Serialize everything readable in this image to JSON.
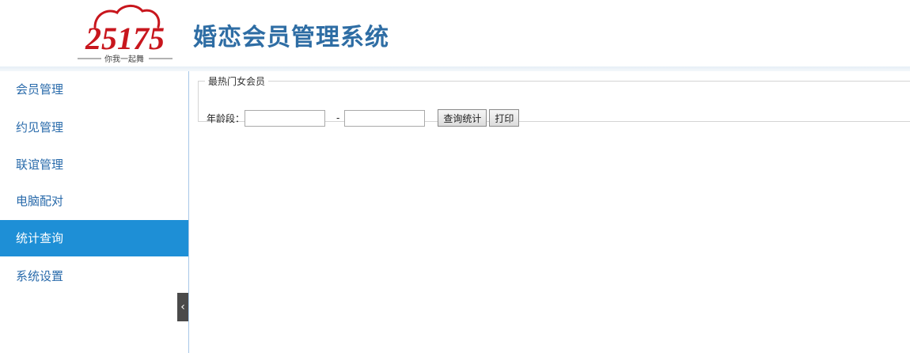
{
  "header": {
    "logo_number": "25175",
    "logo_slogan": "你我一起舞",
    "title": "婚恋会员管理系统",
    "accent_color": "#2e6da4",
    "logo_color": "#c8161d"
  },
  "sidebar": {
    "items": [
      {
        "label": "会员管理",
        "active": false
      },
      {
        "label": "约见管理",
        "active": false
      },
      {
        "label": "联谊管理",
        "active": false
      },
      {
        "label": "电脑配对",
        "active": false
      },
      {
        "label": "统计查询",
        "active": true
      },
      {
        "label": "系统设置",
        "active": false
      }
    ],
    "collapse_glyph": "‹",
    "active_color": "#1e8fd6"
  },
  "panel": {
    "legend": "最热门女会员",
    "age_label": "年龄段：",
    "age_from_value": "",
    "age_separator": "-",
    "age_to_value": "",
    "query_button": "查询统计",
    "print_button": "打印"
  }
}
